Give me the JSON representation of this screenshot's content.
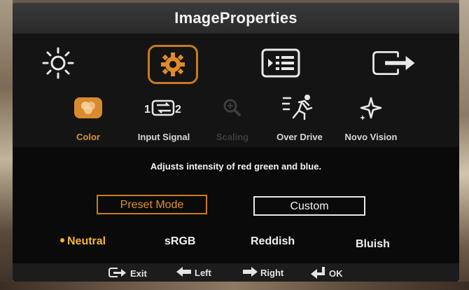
{
  "title": "ImageProperties",
  "top_icons": [
    {
      "name": "brightness-icon",
      "selected": false
    },
    {
      "name": "settings-icon",
      "selected": true
    },
    {
      "name": "menu-list-icon",
      "selected": false
    },
    {
      "name": "exit-icon",
      "selected": false
    }
  ],
  "submenu": [
    {
      "label": "Color",
      "icon": "color-icon",
      "state": "active"
    },
    {
      "label": "Input Signal",
      "icon": "input-signal-icon",
      "state": "normal"
    },
    {
      "label": "Scaling",
      "icon": "zoom-icon",
      "state": "disabled"
    },
    {
      "label": "Over Drive",
      "icon": "running-man-icon",
      "state": "normal"
    },
    {
      "label": "Novo Vision",
      "icon": "sparkle-icon",
      "state": "normal"
    }
  ],
  "description": "Adjusts intensity of red green and blue.",
  "mode_buttons": {
    "preset": "Preset Mode",
    "custom": "Custom"
  },
  "presets": [
    {
      "label": "Neutral",
      "selected": true
    },
    {
      "label": "sRGB",
      "selected": false
    },
    {
      "label": "Reddish",
      "selected": false
    },
    {
      "label": "Bluish",
      "selected": false
    }
  ],
  "footer": {
    "exit": "Exit",
    "left": "Left",
    "right": "Right",
    "ok": "OK"
  },
  "colors": {
    "accent": "#c97a22",
    "selected_text": "#f3b630",
    "background": "#141414"
  }
}
